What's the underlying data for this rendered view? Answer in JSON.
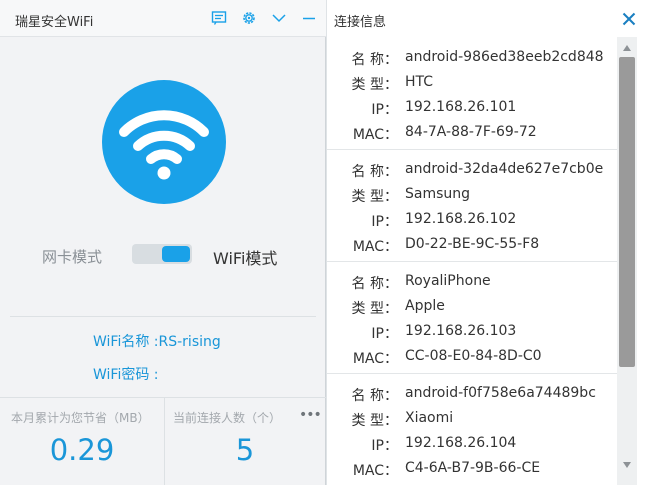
{
  "left_window": {
    "title": "瑞星安全WiFi",
    "toolbar_icons": [
      "list-icon",
      "gear-icon",
      "chevron-down-icon",
      "minimize-icon"
    ],
    "mode_toggle": {
      "left_label": "网卡模式",
      "right_label": "WiFi模式",
      "selected": "WiFi模式"
    },
    "wifi_name": "WiFi名称 :RS-rising",
    "wifi_password": "WiFi密码 :",
    "stats": {
      "saved_label": "本月累计为您节省（MB）",
      "saved_value": "0.29",
      "connected_label": "当前连接人数（个）",
      "connected_value": "5",
      "more_label": "•••"
    },
    "colors": {
      "accent": "#1aa1e8",
      "text_accent": "#1a96d8"
    }
  },
  "right_panel": {
    "title": "连接信息",
    "close_icon": "close-icon",
    "field_labels": {
      "name": "名 称：",
      "type": "类 型：",
      "ip": "IP：",
      "mac": "MAC："
    },
    "devices": [
      {
        "name": "android-986ed38eeb2cd848",
        "type": "HTC",
        "ip": "192.168.26.101",
        "mac": "84-7A-88-7F-69-72"
      },
      {
        "name": "android-32da4de627e7cb0e",
        "type": "Samsung",
        "ip": "192.168.26.102",
        "mac": "D0-22-BE-9C-55-F8"
      },
      {
        "name": "RoyaliPhone",
        "type": "Apple",
        "ip": "192.168.26.103",
        "mac": "CC-08-E0-84-8D-C0"
      },
      {
        "name": "android-f0f758e6a74489bc",
        "type": "Xiaomi",
        "ip": "192.168.26.104",
        "mac": "C4-6A-B7-9B-66-CE"
      }
    ]
  }
}
